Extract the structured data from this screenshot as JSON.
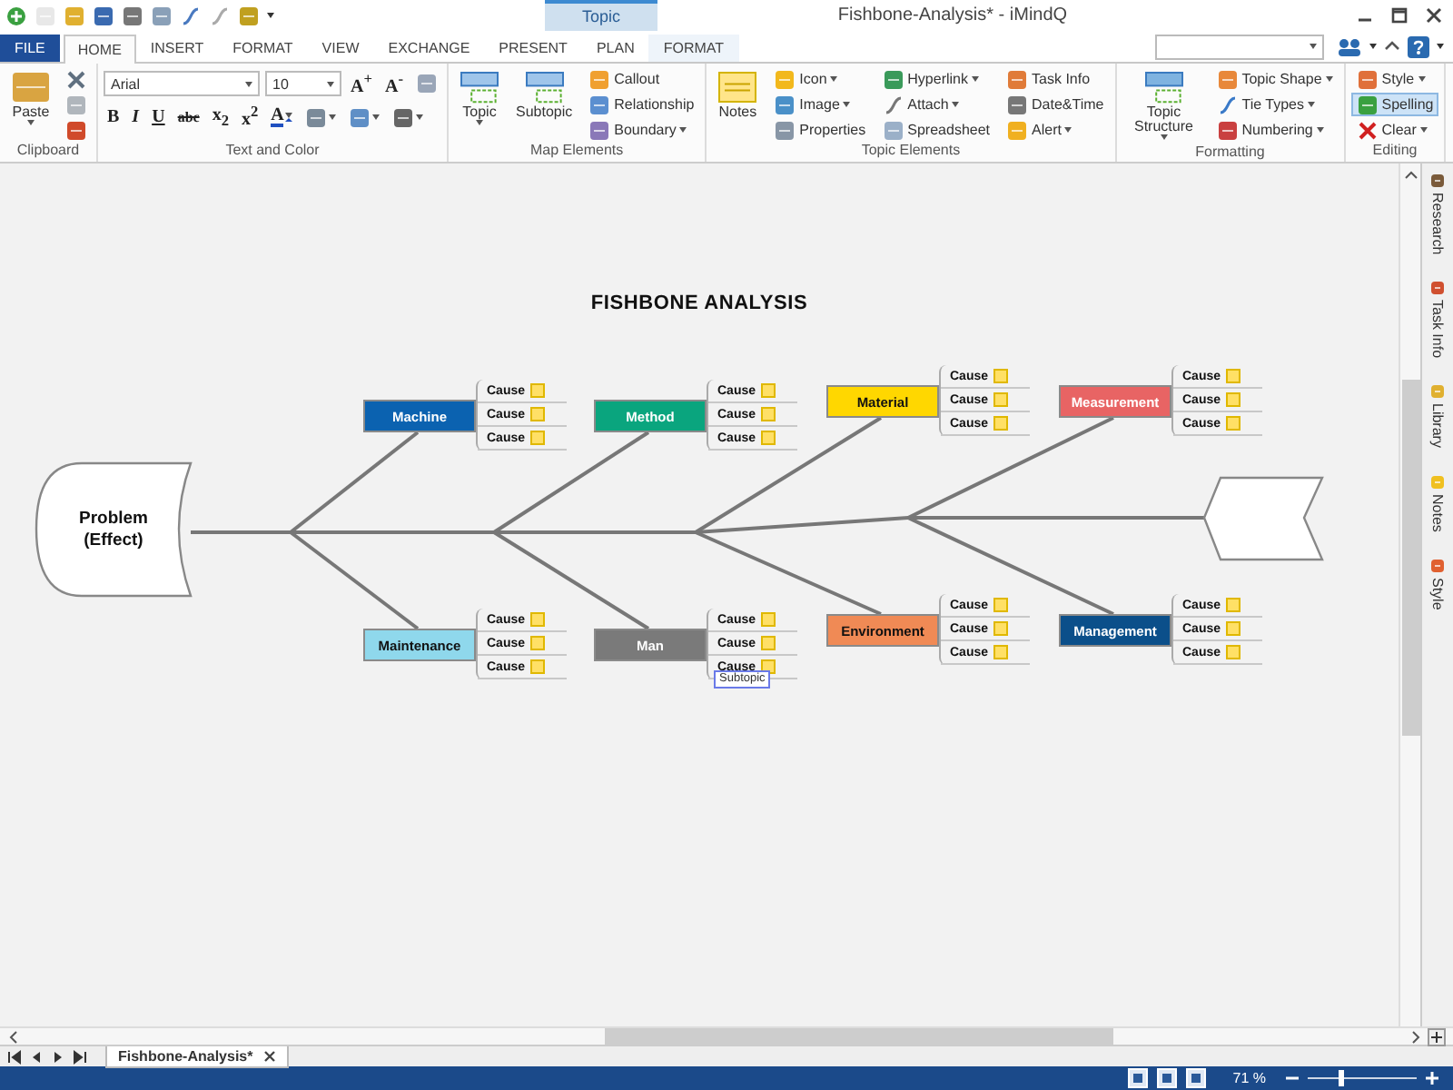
{
  "app": {
    "title": "Fishbone-Analysis* - iMindQ",
    "context_tab": "Topic"
  },
  "ribbon_tabs": [
    {
      "label": "FILE",
      "kind": "file",
      "selected": false
    },
    {
      "label": "HOME",
      "kind": "plain",
      "selected": true
    },
    {
      "label": "INSERT",
      "kind": "plain",
      "selected": false
    },
    {
      "label": "FORMAT",
      "kind": "plain",
      "selected": false
    },
    {
      "label": "VIEW",
      "kind": "plain",
      "selected": false
    },
    {
      "label": "EXCHANGE",
      "kind": "plain",
      "selected": false
    },
    {
      "label": "PRESENT",
      "kind": "plain",
      "selected": false
    },
    {
      "label": "PLAN",
      "kind": "plain",
      "selected": false
    },
    {
      "label": "FORMAT",
      "kind": "context",
      "selected": false
    }
  ],
  "ribbon_groups": [
    {
      "label": "Clipboard",
      "kind": "columns",
      "lines": [
        [
          {
            "kind": "large",
            "label": "Paste",
            "dropdown": true
          }
        ],
        [
          {
            "kind": "icon",
            "dropdown": false
          },
          {
            "kind": "icon",
            "dropdown": false
          },
          {
            "kind": "icon",
            "dropdown": false
          }
        ]
      ]
    },
    {
      "label": "Text and Color",
      "kind": "rows",
      "lines": [
        [
          {
            "kind": "combo",
            "value": "Arial",
            "dropdown": true
          },
          {
            "kind": "combo",
            "value": "10",
            "dropdown": true
          },
          {
            "kind": "glyph",
            "label": "A$^{+}$",
            "dropdown": false
          },
          {
            "kind": "glyph",
            "label": "A$^{-}$",
            "dropdown": false
          },
          {
            "kind": "icon",
            "dropdown": false
          }
        ],
        [
          {
            "kind": "bold",
            "label": "B",
            "dropdown": false
          },
          {
            "kind": "italic",
            "label": "I",
            "dropdown": false
          },
          {
            "kind": "underline",
            "label": "U",
            "dropdown": false
          },
          {
            "kind": "strike",
            "label": "abc",
            "dropdown": false
          },
          {
            "kind": "glyph",
            "label": "x$_{2}$",
            "dropdown": false
          },
          {
            "kind": "glyph",
            "label": "x$^{2}$",
            "dropdown": false
          },
          {
            "kind": "fontcolor",
            "label": "A",
            "dropdown": true
          },
          {
            "kind": "icon",
            "dropdown": true
          },
          {
            "kind": "icon",
            "dropdown": true
          },
          {
            "kind": "icon",
            "dropdown": true
          }
        ]
      ]
    },
    {
      "label": "Map Elements",
      "kind": "columns",
      "lines": [
        [
          {
            "kind": "large",
            "label": "Topic",
            "dropdown": true
          }
        ],
        [
          {
            "kind": "large",
            "label": "Subtopic",
            "dropdown": false
          }
        ],
        [
          {
            "kind": "small",
            "label": "Callout",
            "dropdown": false
          },
          {
            "kind": "small",
            "label": "Relationship",
            "dropdown": false
          },
          {
            "kind": "small",
            "label": "Boundary",
            "dropdown": true
          }
        ]
      ]
    },
    {
      "label": "Topic Elements",
      "kind": "columns",
      "lines": [
        [
          {
            "kind": "large",
            "label": "Notes",
            "dropdown": false
          }
        ],
        [
          {
            "kind": "small",
            "label": "Icon",
            "dropdown": true
          },
          {
            "kind": "small",
            "label": "Image",
            "dropdown": true
          },
          {
            "kind": "small",
            "label": "Properties",
            "dropdown": false
          }
        ],
        [
          {
            "kind": "small",
            "label": "Hyperlink",
            "dropdown": true
          },
          {
            "kind": "small",
            "label": "Attach",
            "dropdown": true
          },
          {
            "kind": "small",
            "label": "Spreadsheet",
            "dropdown": false
          }
        ],
        [
          {
            "kind": "small",
            "label": "Task Info",
            "dropdown": false
          },
          {
            "kind": "small",
            "label": "Date&Time",
            "dropdown": false
          },
          {
            "kind": "small",
            "label": "Alert",
            "dropdown": true
          }
        ]
      ]
    },
    {
      "label": "Formatting",
      "kind": "columns",
      "lines": [
        [
          {
            "kind": "large",
            "label": "Topic Structure",
            "dropdown": true
          }
        ],
        [
          {
            "kind": "small",
            "label": "Topic Shape",
            "dropdown": true
          },
          {
            "kind": "small",
            "label": "Tie Types",
            "dropdown": true
          },
          {
            "kind": "small",
            "label": "Numbering",
            "dropdown": true
          }
        ]
      ]
    },
    {
      "label": "Editing",
      "kind": "columns",
      "lines": [
        [
          {
            "kind": "small",
            "label": "Style",
            "dropdown": true,
            "on": false
          },
          {
            "kind": "small",
            "label": "Spelling",
            "dropdown": false,
            "on": true
          },
          {
            "kind": "small",
            "label": "Clear",
            "dropdown": true,
            "on": false
          }
        ]
      ]
    }
  ],
  "diagram": {
    "title": "FISHBONE ANALYSIS",
    "effect": "Problem (Effect)",
    "edit_hint": "Subtopic",
    "categories": [
      {
        "label": "Machine",
        "color": "#0b62b0",
        "causes": [
          "Cause",
          "Cause",
          "Cause"
        ]
      },
      {
        "label": "Method",
        "color": "#0aa57e",
        "causes": [
          "Cause",
          "Cause",
          "Cause"
        ]
      },
      {
        "label": "Material",
        "color": "#ffd700",
        "causes": [
          "Cause",
          "Cause",
          "Cause"
        ]
      },
      {
        "label": "Measurement",
        "color": "#e86464",
        "causes": [
          "Cause",
          "Cause",
          "Cause"
        ]
      },
      {
        "label": "Maintenance",
        "color": "#8fd8ec",
        "causes": [
          "Cause",
          "Cause",
          "Cause"
        ]
      },
      {
        "label": "Man",
        "color": "#7a7a7a",
        "causes": [
          "Cause",
          "Cause",
          "Cause"
        ]
      },
      {
        "label": "Environment",
        "color": "#f08a55",
        "causes": [
          "Cause",
          "Cause",
          "Cause"
        ]
      },
      {
        "label": "Management",
        "color": "#0b4f8a",
        "causes": [
          "Cause",
          "Cause",
          "Cause"
        ]
      }
    ]
  },
  "side_panel": [
    {
      "label": "Research"
    },
    {
      "label": "Task Info"
    },
    {
      "label": "Library"
    },
    {
      "label": "Notes"
    },
    {
      "label": "Style"
    }
  ],
  "sheet_tabs": [
    {
      "label": "Fishbone-Analysis*",
      "selected": true
    }
  ],
  "status_bar": {
    "zoom": "71 %",
    "zoom_slider": {
      "level": 0.3
    }
  }
}
